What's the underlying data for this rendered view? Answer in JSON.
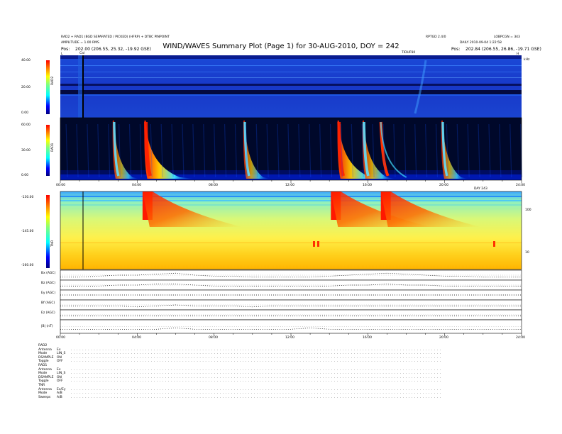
{
  "header": {
    "title": "WIND/WAVES Summary Plot (Page 1) for 30-AUG-2010, DOY = 242",
    "left_line1": "RAD2 + RAD1 (BGD SEPARATED / PICKED) (HFRP) + DTBC PINPOINT",
    "left_line2": "AMPLITUDE = 1.00 RMS",
    "left_pos_label": "Pos:",
    "left_pos_value": "202.00 (206.55, 25.32, -19.92 GSE)",
    "right_line1": "RPTGD 2.4/0",
    "right_line2": "LOBPCGN = 343",
    "right_line3": "DAILY 2010-09-04 1:22:58",
    "right_pos_label": "Pos:",
    "right_pos_value": "202.84 (206.55, 26.86, -19.71 GSE)",
    "marker_label": "Cal",
    "time_mid": "TIDUP30",
    "corner_left": "L",
    "corner_right": "H",
    "units_right": "kHz"
  },
  "chart_data": [
    {
      "type": "heatmap",
      "panel": "RAD2",
      "ylabel": "RAD2",
      "yticks": [
        "0.00",
        "20.00",
        "40.00"
      ],
      "ylim": [
        0,
        40
      ],
      "note": "dynamic spectrum, time 00:00-24:00"
    },
    {
      "type": "heatmap",
      "panel": "RAD1",
      "ylabel": "RAD1",
      "yticks": [
        "0.00",
        "30.00",
        "60.00"
      ],
      "ylim": [
        0,
        60
      ],
      "xticks": [
        "00:00",
        "04:00",
        "08:00",
        "12:00",
        "16:00",
        "20:00",
        "24:00"
      ],
      "xlim": [
        0,
        24
      ],
      "x_end_label": "DAY 243",
      "bursts_hours": [
        2.8,
        4.45,
        9.6,
        14.5,
        15.8,
        19.9
      ],
      "note": "type III radio bursts; strongest near 04:30, 14:30, 16:50"
    },
    {
      "type": "heatmap",
      "panel": "TNR",
      "ylabel": "TNR",
      "yticks": [
        "-160.00",
        "-145.00",
        "-130.00"
      ],
      "ylim": [
        -160,
        -130
      ],
      "right_ticks": [
        "10",
        "100"
      ],
      "bright_hours": [
        4.5,
        14.3,
        16.9
      ]
    },
    {
      "type": "line",
      "panel": "ancillary",
      "xticks": [
        "00:00",
        "04:00",
        "08:00",
        "12:00",
        "16:00",
        "20:00",
        "24:00"
      ],
      "xlim": [
        0,
        24
      ],
      "series": [
        {
          "name": "Bx (AGC)",
          "values": [
            0.3,
            0.3,
            0.4,
            0.5,
            0.5,
            0.6,
            0.7,
            0.5,
            0.4,
            0.4,
            0.3,
            0.3,
            0.3,
            0.3,
            0.4,
            0.5,
            0.6,
            0.7,
            0.6,
            0.5,
            0.4,
            0.4,
            0.3,
            0.3,
            0.3
          ]
        },
        {
          "name": "Bz (AGC)",
          "values": [
            0.4,
            0.4,
            0.4,
            0.5,
            0.5,
            0.6,
            0.6,
            0.5,
            0.4,
            0.4,
            0.4,
            0.4,
            0.4,
            0.4,
            0.4,
            0.5,
            0.5,
            0.6,
            0.5,
            0.5,
            0.4,
            0.4,
            0.4,
            0.4,
            0.4
          ]
        },
        {
          "name": "Ey (AGC)",
          "values": [
            0.5,
            0.5,
            0.5,
            0.5,
            0.5,
            0.5,
            0.5,
            0.5,
            0.5,
            0.5,
            0.5,
            0.5,
            0.5,
            0.5,
            0.5,
            0.5,
            0.5,
            0.5,
            0.5,
            0.5,
            0.5,
            0.5,
            0.5,
            0.5,
            0.5
          ]
        },
        {
          "name": "Bf (AGC)",
          "values": [
            0.4,
            0.4,
            0.4,
            0.4,
            0.3,
            0.4,
            0.5,
            0.4,
            0.4,
            0.4,
            0.3,
            0.4,
            0.4,
            0.4,
            0.4,
            0.4,
            0.4,
            0.4,
            0.4,
            0.4,
            0.4,
            0.4,
            0.4,
            0.4,
            0.4
          ]
        },
        {
          "name": "Ez (AGC)",
          "values": [
            0.4,
            0.4,
            0.4,
            0.4,
            0.4,
            0.4,
            0.4,
            0.4,
            0.4,
            0.4,
            0.4,
            0.4,
            0.4,
            0.4,
            0.4,
            0.4,
            0.4,
            0.4,
            0.4,
            0.4,
            0.4,
            0.4,
            0.4,
            0.4,
            0.4
          ]
        },
        {
          "name": "|B| (nT)",
          "values": [
            0.3,
            0.3,
            0.3,
            0.3,
            0.3,
            0.3,
            0.4,
            0.3,
            0.3,
            0.3,
            0.3,
            0.3,
            0.3,
            0.4,
            0.3,
            0.3,
            0.3,
            0.3,
            0.3,
            0.3,
            0.3,
            0.3,
            0.3,
            0.3,
            0.3
          ]
        }
      ],
      "right_ticks": [
        "100",
        "10",
        "1"
      ]
    }
  ],
  "footer": {
    "rows": [
      {
        "label": "RAD2",
        "value": ""
      },
      {
        "label": "Antenna",
        "value": "Ex"
      },
      {
        "label": "Mode",
        "value": "LIN_S"
      },
      {
        "label": "DSAMPLE",
        "value": "ON"
      },
      {
        "label": "Toggle",
        "value": "OFF"
      },
      {
        "label": "RAD1",
        "value": ""
      },
      {
        "label": "Antenna",
        "value": "Ex"
      },
      {
        "label": "Mode",
        "value": "LIN_S"
      },
      {
        "label": "DSAMPLE",
        "value": "ON"
      },
      {
        "label": "Toggle",
        "value": "OFF"
      },
      {
        "label": "TNR",
        "value": ""
      },
      {
        "label": "Antenna",
        "value": "Ex/Ey"
      },
      {
        "label": "Mode",
        "value": "A/B"
      },
      {
        "label": "Sweeps",
        "value": "A/B"
      }
    ]
  },
  "colors": {
    "background_blue": "#1030c0",
    "dark": "#000020",
    "tnr_base": "#ffd21e"
  }
}
